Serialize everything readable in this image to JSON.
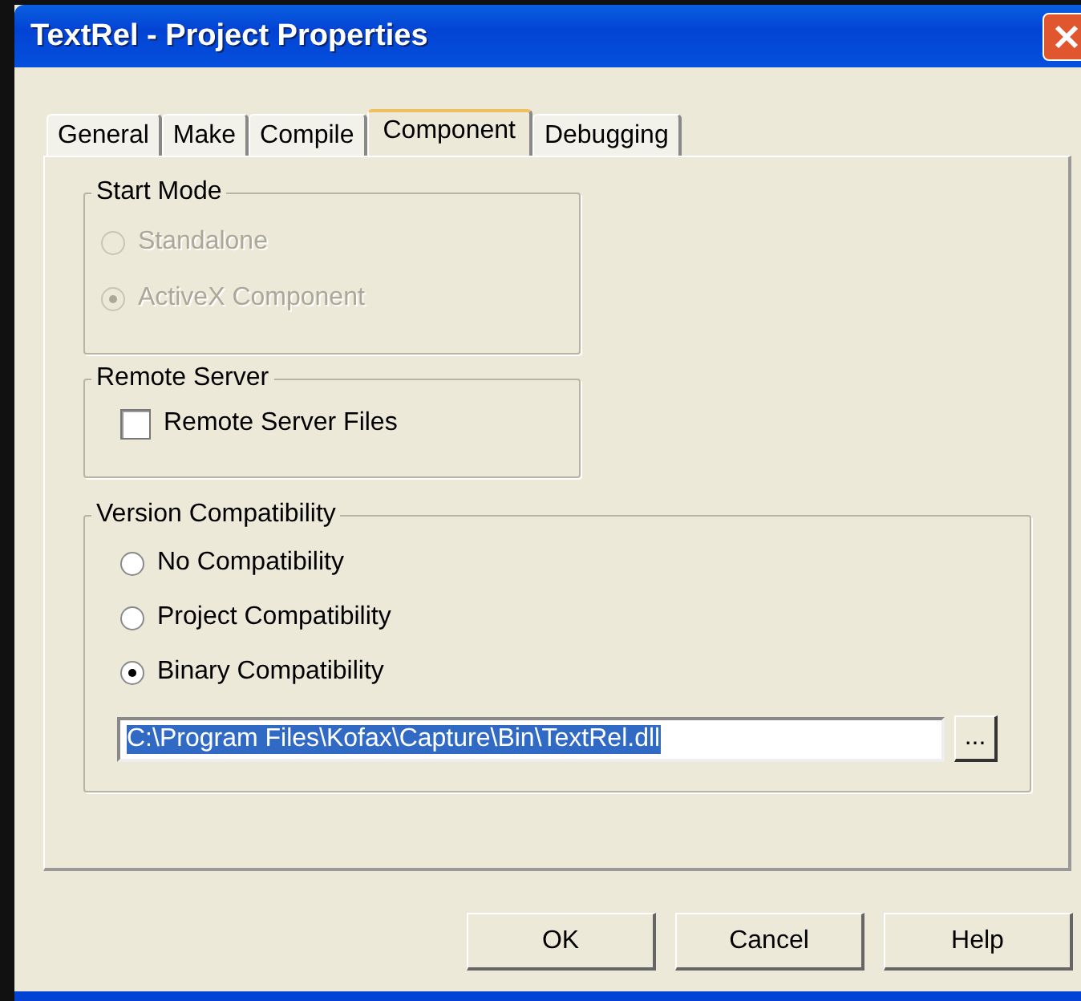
{
  "window": {
    "title": "TextRel - Project Properties"
  },
  "tabs": [
    {
      "label": "General",
      "selected": false
    },
    {
      "label": "Make",
      "selected": false
    },
    {
      "label": "Compile",
      "selected": false
    },
    {
      "label": "Component",
      "selected": true
    },
    {
      "label": "Debugging",
      "selected": false
    }
  ],
  "start_mode": {
    "title": "Start Mode",
    "options": [
      {
        "label": "Standalone",
        "selected": false,
        "disabled": true
      },
      {
        "label": "ActiveX Component",
        "selected": true,
        "disabled": true
      }
    ]
  },
  "remote_server": {
    "title": "Remote Server",
    "checkbox": {
      "label": "Remote Server Files",
      "checked": false
    }
  },
  "version_compatibility": {
    "title": "Version Compatibility",
    "options": [
      {
        "label": "No Compatibility",
        "selected": false,
        "disabled": false
      },
      {
        "label": "Project Compatibility",
        "selected": false,
        "disabled": false
      },
      {
        "label": "Binary Compatibility",
        "selected": true,
        "disabled": false
      }
    ],
    "path": {
      "value": "C:\\Program Files\\Kofax\\Capture\\Bin\\TextRel.dll",
      "text_selected": true
    },
    "browse_button": "..."
  },
  "buttons": [
    "OK",
    "Cancel",
    "Help"
  ]
}
